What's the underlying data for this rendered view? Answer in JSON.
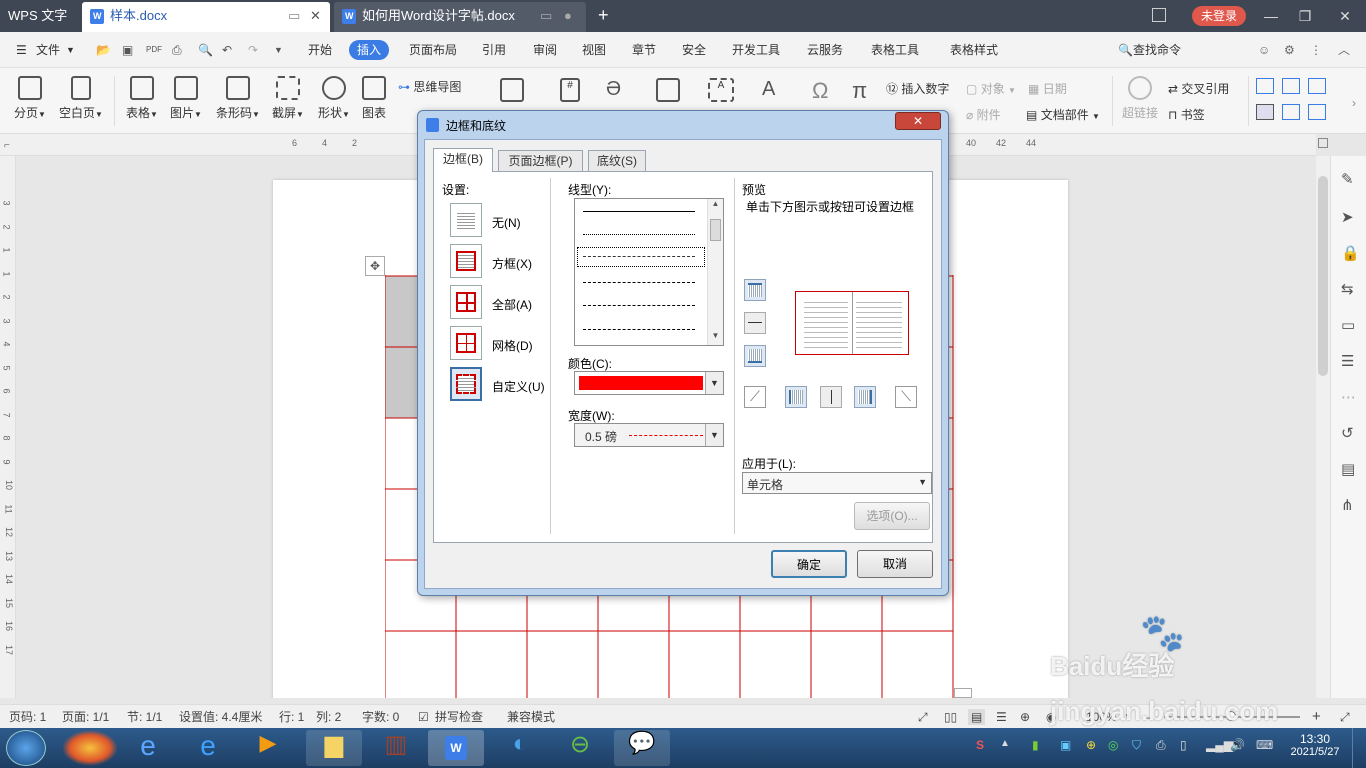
{
  "titlebar": {
    "app_name": "WPS 文字",
    "tabs": [
      {
        "label": "样本.docx"
      },
      {
        "label": "如何用Word设计字帖.docx"
      }
    ],
    "login_label": "未登录"
  },
  "menubar": {
    "file_label": "文件",
    "items": [
      "开始",
      "插入",
      "页面布局",
      "引用",
      "审阅",
      "视图",
      "章节",
      "安全",
      "开发工具",
      "云服务",
      "表格工具",
      "表格样式"
    ],
    "active": "插入",
    "search_label": "查找命令"
  },
  "ribbon": {
    "items": [
      "分页",
      "空白页",
      "表格",
      "图片",
      "条形码",
      "截屏",
      "形状",
      "图表"
    ],
    "mindmap": "思维导图",
    "insert_number": "插入数字",
    "object": "对象",
    "date": "日期",
    "attachment": "附件",
    "doc_parts": "文档部件",
    "hyperlink": "超链接",
    "cross_ref": "交叉引用",
    "bookmark": "书签"
  },
  "ruler": {
    "left_ticks": [
      "6",
      "4",
      "2"
    ],
    "right_ticks": [
      "40",
      "42",
      "44"
    ],
    "vertical_ticks": [
      "3",
      "2",
      "1",
      "1",
      "2",
      "3",
      "4",
      "5",
      "6",
      "7",
      "8",
      "9",
      "10",
      "11",
      "12",
      "13",
      "14",
      "15",
      "16",
      "17"
    ]
  },
  "dialog": {
    "title": "边框和底纹",
    "tabs": [
      "边框(B)",
      "页面边框(P)",
      "底纹(S)"
    ],
    "settings_label": "设置:",
    "settings": [
      "无(N)",
      "方框(X)",
      "全部(A)",
      "网格(D)",
      "自定义(U)"
    ],
    "line_style_label": "线型(Y):",
    "color_label": "颜色(C):",
    "color_value": "#ff0000",
    "width_label": "宽度(W):",
    "width_value": "0.5 磅",
    "preview_label": "预览",
    "preview_hint": "单击下方图示或按钮可设置边框",
    "apply_label": "应用于(L):",
    "apply_value": "单元格",
    "options_button": "选项(O)...",
    "ok_button": "确定",
    "cancel_button": "取消"
  },
  "statusbar": {
    "page_no": "页码: 1",
    "pages": "页面: 1/1",
    "section": "节: 1/1",
    "setting": "设置值: 4.4厘米",
    "row": "行: 1",
    "col": "列: 2",
    "words": "字数: 0",
    "spell": "拼写检查",
    "compat": "兼容模式",
    "zoom": "100%"
  },
  "taskbar": {
    "time": "13:30",
    "date": "2021/5/27"
  },
  "watermark": "Baidu经验 jingyan.baidu.com",
  "colors": {
    "accent": "#3a7ce4",
    "border_red": "#cc0000",
    "titlebar": "#3f4654",
    "login": "#e0574c"
  }
}
